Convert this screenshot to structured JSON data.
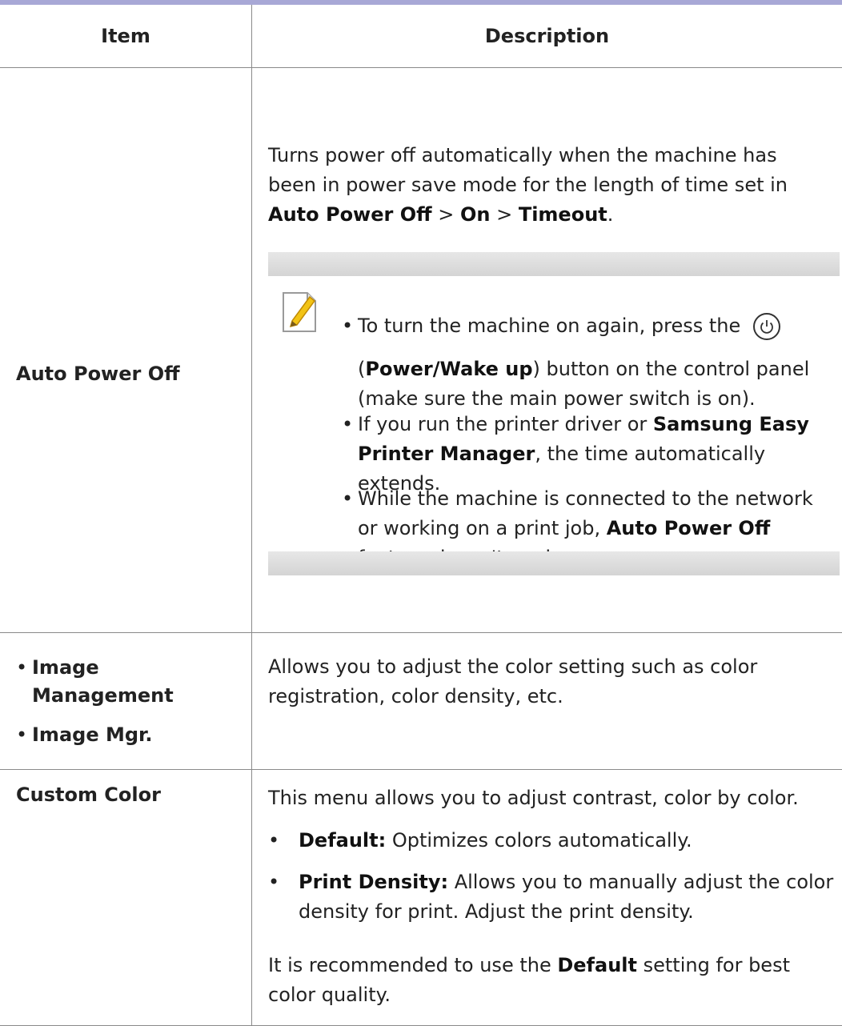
{
  "header": {
    "item": "Item",
    "description": "Description"
  },
  "row1": {
    "item": "Auto Power Off",
    "desc_lines": [
      "Turns power off automatically when the machine has",
      "been in power save mode for the length of time set in"
    ],
    "path": {
      "a": "Auto Power Off",
      "sep1": ">",
      "b": "On",
      "sep2": ">",
      "c": "Timeout",
      "end": "."
    },
    "note": {
      "b1": {
        "line1": "To turn the machine on again, press the",
        "paren_open": "(",
        "bold": "Power/Wake up",
        "rest": ") button on the control panel",
        "line3": "(make sure the main power switch is on)."
      },
      "b2": {
        "pre": "If you run the printer driver or ",
        "bold": "Samsung Easy Printer Manager",
        "post": ", the time automatically extends."
      },
      "b3": {
        "pre": "While the machine is connected to the network or working on a print job, ",
        "bold": "Auto Power Off",
        "post": " feature doesn't work."
      }
    }
  },
  "row2": {
    "items": [
      "Image Management",
      "Image Mgr."
    ],
    "desc": "Allows you to adjust the color setting such as color registration, color density, etc."
  },
  "row3": {
    "item": "Custom Color",
    "intro": "This menu allows you to adjust contrast, color by color.",
    "b1": {
      "bold": "Default:",
      "text": " Optimizes colors automatically."
    },
    "b2": {
      "bold": "Print Density:",
      "text": " Allows you to manually adjust the color density for print. Adjust the print density."
    },
    "outro": {
      "pre": "It is recommended to use the ",
      "bold": "Default",
      "post": " setting for best color quality."
    }
  },
  "bullet_char": "•"
}
